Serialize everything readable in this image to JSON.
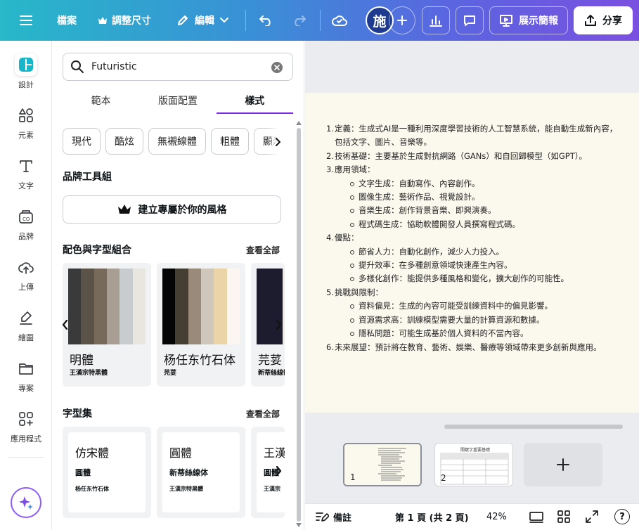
{
  "topbar": {
    "menu_icon": "hamburger-icon",
    "file_label": "檔案",
    "resize_label": "調整尺寸",
    "edit_label": "編輯",
    "avatar_initial": "施",
    "present_label": "展示簡報",
    "share_label": "分享",
    "gradient_colors": [
      "#27b8c9",
      "#5a66e0",
      "#7b4fe0"
    ]
  },
  "rail": {
    "items": [
      {
        "label": "設計",
        "icon": "design-icon"
      },
      {
        "label": "元素",
        "icon": "elements-icon"
      },
      {
        "label": "文字",
        "icon": "text-icon"
      },
      {
        "label": "品牌",
        "icon": "brand-icon"
      },
      {
        "label": "上傳",
        "icon": "upload-icon"
      },
      {
        "label": "繪圖",
        "icon": "draw-icon"
      },
      {
        "label": "專案",
        "icon": "folder-icon"
      },
      {
        "label": "應用程式",
        "icon": "apps-icon"
      }
    ],
    "magic_icon": "sparkle-icon"
  },
  "panel": {
    "search": {
      "value": "Futuristic",
      "placeholder": ""
    },
    "tabs": [
      {
        "label": "範本",
        "active": false
      },
      {
        "label": "版面配置",
        "active": false
      },
      {
        "label": "樣式",
        "active": true
      }
    ],
    "chips": [
      "現代",
      "酷炫",
      "無襯線體",
      "粗體",
      "顯示"
    ],
    "brand_kit": {
      "title": "品牌工具組",
      "button_label": "建立專屬於你的風格"
    },
    "combos": {
      "title": "配色與字型組合",
      "see_all": "查看全部",
      "cards": [
        {
          "font": "明體",
          "sub": "王漢宗特黑體",
          "colors": [
            "#3a3a3a",
            "#5b5248",
            "#776a5a",
            "#a89e93",
            "#c9ccce",
            "#e9e6e0"
          ]
        },
        {
          "font": "杨任东竹石体",
          "sub": "芫荽",
          "colors": [
            "#050505",
            "#453e33",
            "#9a8a7a",
            "#cfc6bc",
            "#ead4a8",
            "#fbf6ef"
          ]
        },
        {
          "font": "芫荽",
          "sub": "新蒂絲線體",
          "colors": [
            "#1d1b2e",
            "#ecebea",
            "#f4f1ec"
          ]
        }
      ]
    },
    "fonts": {
      "title": "字型集",
      "see_all": "查看全部",
      "cards": [
        {
          "l1": "仿宋體",
          "l2": "圓體",
          "l3": "杨任东竹石体"
        },
        {
          "l1": "圓體",
          "l2": "新蒂絲線体",
          "l3": "王漢宗特黑體"
        },
        {
          "l1": "王漢",
          "l2": "圓體",
          "l3": "王漢宗"
        }
      ]
    }
  },
  "document": {
    "items": [
      {
        "num": "1.",
        "text": "定義：生成式AI是一種利用深度學習技術的人工智慧系統，能自動生成新內容，包括文字、圖片、音樂等。",
        "sub": []
      },
      {
        "num": "2.",
        "text": "技術基礎：主要基於生成對抗網路（GANs）和自回歸模型（如GPT）。",
        "sub": []
      },
      {
        "num": "3.",
        "text": "應用領域：",
        "sub": [
          "文字生成：自動寫作、內容創作。",
          "圖像生成：藝術作品、視覺設計。",
          "音樂生成：創作背景音樂、即興演奏。",
          "程式碼生成：協助軟體開發人員撰寫程式碼。"
        ]
      },
      {
        "num": "4.",
        "text": "優點：",
        "sub": [
          "節省人力：自動化創作，減少人力投入。",
          "提升效率：在多種創意領域快速產生內容。",
          "多樣化創作：能提供多種風格和變化，擴大創作的可能性。"
        ]
      },
      {
        "num": "5.",
        "text": "挑戰與限制：",
        "sub": [
          "資料偏見：生成的內容可能受訓練資料中的偏見影響。",
          "資源需求高：訓練模型需要大量的計算資源和數據。",
          "隱私問題：可能生成基於個人資料的不當內容。"
        ]
      },
      {
        "num": "6.",
        "text": "未來展望：預計將在教育、藝術、娛樂、醫療等領域帶來更多創新與應用。",
        "sub": []
      }
    ]
  },
  "pages": [
    {
      "number": "1",
      "selected": true,
      "title": ""
    },
    {
      "number": "2",
      "selected": false,
      "title": "關鍵字重要基礎"
    }
  ],
  "footer": {
    "notes_label": "備註",
    "page_label": "第 1 頁 (共 2 頁)",
    "zoom": "42%",
    "help": "?"
  }
}
